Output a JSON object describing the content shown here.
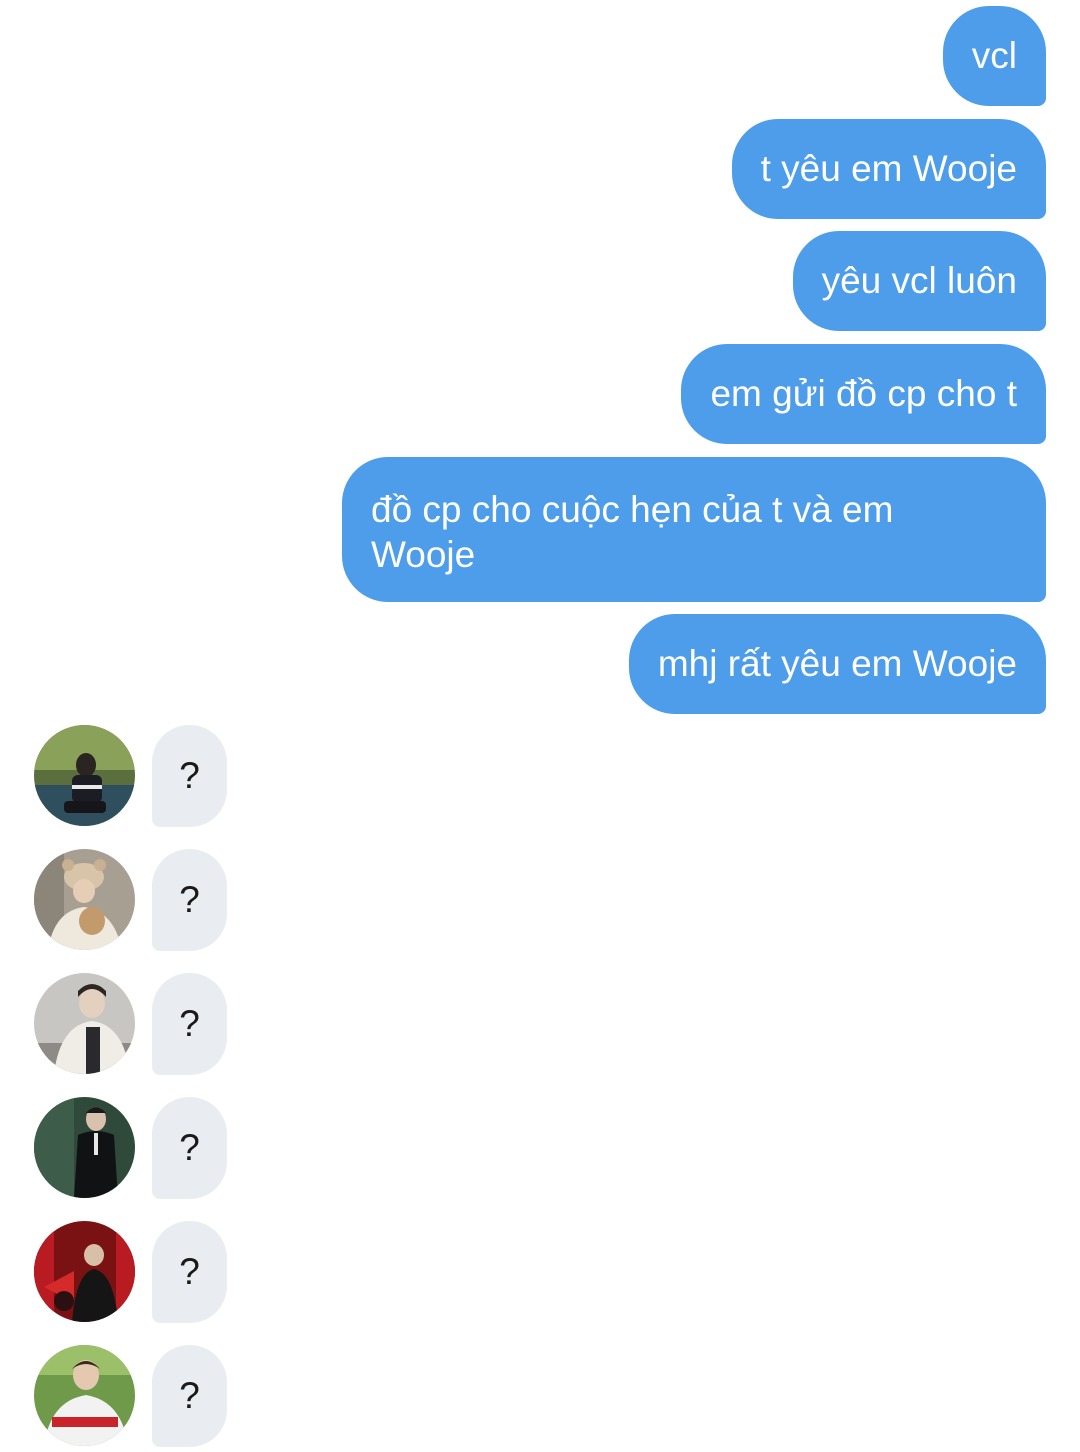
{
  "thread": {
    "outgoing": [
      {
        "text": "vcl"
      },
      {
        "text": "t yêu em Wooje"
      },
      {
        "text": "yêu vcl luôn"
      },
      {
        "text": "em gửi đồ cp cho t"
      },
      {
        "text": "đồ cp cho cuộc hẹn của t và em\nWooje"
      },
      {
        "text": "mhj rất yêu em Wooje"
      }
    ],
    "incoming": [
      {
        "avatar": "avatar-photo",
        "text": "?"
      },
      {
        "avatar": "avatar-photo",
        "text": "?"
      },
      {
        "avatar": "avatar-photo",
        "text": "?"
      },
      {
        "avatar": "avatar-photo",
        "text": "?"
      },
      {
        "avatar": "avatar-photo",
        "text": "?"
      },
      {
        "avatar": "avatar-photo",
        "text": "?"
      }
    ]
  },
  "colors": {
    "outgoing_bubble": "#4d9deb",
    "incoming_bubble": "#e9edf1",
    "background": "#ffffff"
  }
}
